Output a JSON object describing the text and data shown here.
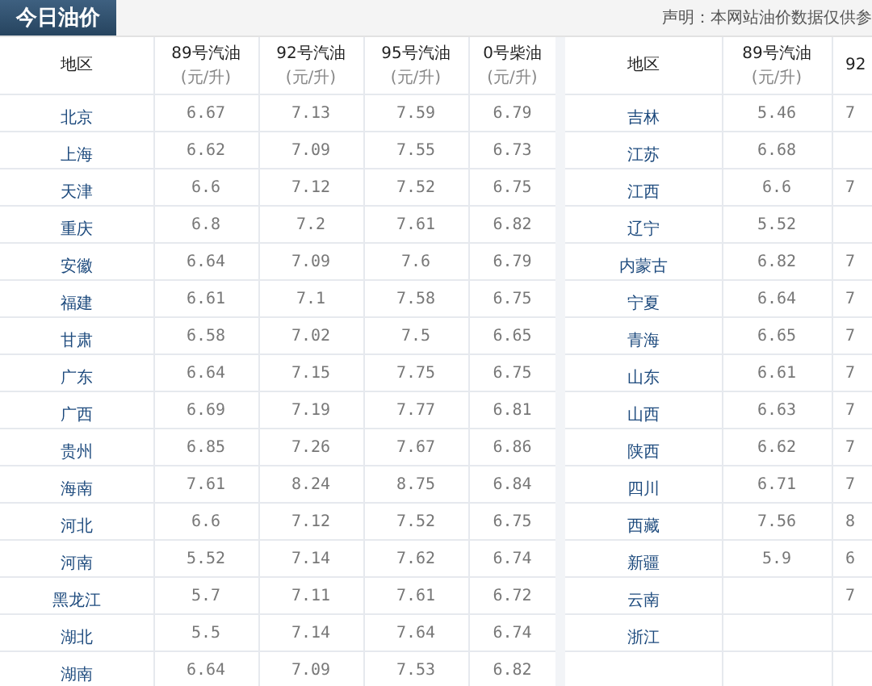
{
  "title": "今日油价",
  "notice": "声明：本网站油价数据仅供参",
  "table": {
    "columns": [
      {
        "name": "地区"
      },
      {
        "name": "89号汽油",
        "unit": "(元/升)"
      },
      {
        "name": "92号汽油",
        "unit": "(元/升)"
      },
      {
        "name": "95号汽油",
        "unit": "(元/升)"
      },
      {
        "name": "0号柴油",
        "unit": "(元/升)"
      },
      {
        "name": "地区"
      },
      {
        "name": "89号汽油",
        "unit": "(元/升)"
      },
      {
        "name": "92"
      }
    ],
    "rows": [
      [
        "北京",
        "6.67",
        "7.13",
        "7.59",
        "6.79",
        "吉林",
        "5.46",
        "7"
      ],
      [
        "上海",
        "6.62",
        "7.09",
        "7.55",
        "6.73",
        "江苏",
        "6.68",
        null
      ],
      [
        "天津",
        "6.6",
        "7.12",
        "7.52",
        "6.75",
        "江西",
        "6.6",
        "7"
      ],
      [
        "重庆",
        "6.8",
        "7.2",
        "7.61",
        "6.82",
        "辽宁",
        "5.52",
        null
      ],
      [
        "安徽",
        "6.64",
        "7.09",
        "7.6",
        "6.79",
        "内蒙古",
        "6.82",
        "7"
      ],
      [
        "福建",
        "6.61",
        "7.1",
        "7.58",
        "6.75",
        "宁夏",
        "6.64",
        "7"
      ],
      [
        "甘肃",
        "6.58",
        "7.02",
        "7.5",
        "6.65",
        "青海",
        "6.65",
        "7"
      ],
      [
        "广东",
        "6.64",
        "7.15",
        "7.75",
        "6.75",
        "山东",
        "6.61",
        "7"
      ],
      [
        "广西",
        "6.69",
        "7.19",
        "7.77",
        "6.81",
        "山西",
        "6.63",
        "7"
      ],
      [
        "贵州",
        "6.85",
        "7.26",
        "7.67",
        "6.86",
        "陕西",
        "6.62",
        "7"
      ],
      [
        "海南",
        "7.61",
        "8.24",
        "8.75",
        "6.84",
        "四川",
        "6.71",
        "7"
      ],
      [
        "河北",
        "6.6",
        "7.12",
        "7.52",
        "6.75",
        "西藏",
        "7.56",
        "8"
      ],
      [
        "河南",
        "5.52",
        "7.14",
        "7.62",
        "6.74",
        "新疆",
        "5.9",
        "6"
      ],
      [
        "黑龙江",
        "5.7",
        "7.11",
        "7.61",
        "6.72",
        "云南",
        null,
        "7"
      ],
      [
        "湖北",
        "5.5",
        "7.14",
        "7.64",
        "6.74",
        "浙江",
        null,
        null
      ],
      [
        "湖南",
        "6.64",
        "7.09",
        "7.53",
        "6.82"
      ]
    ]
  }
}
